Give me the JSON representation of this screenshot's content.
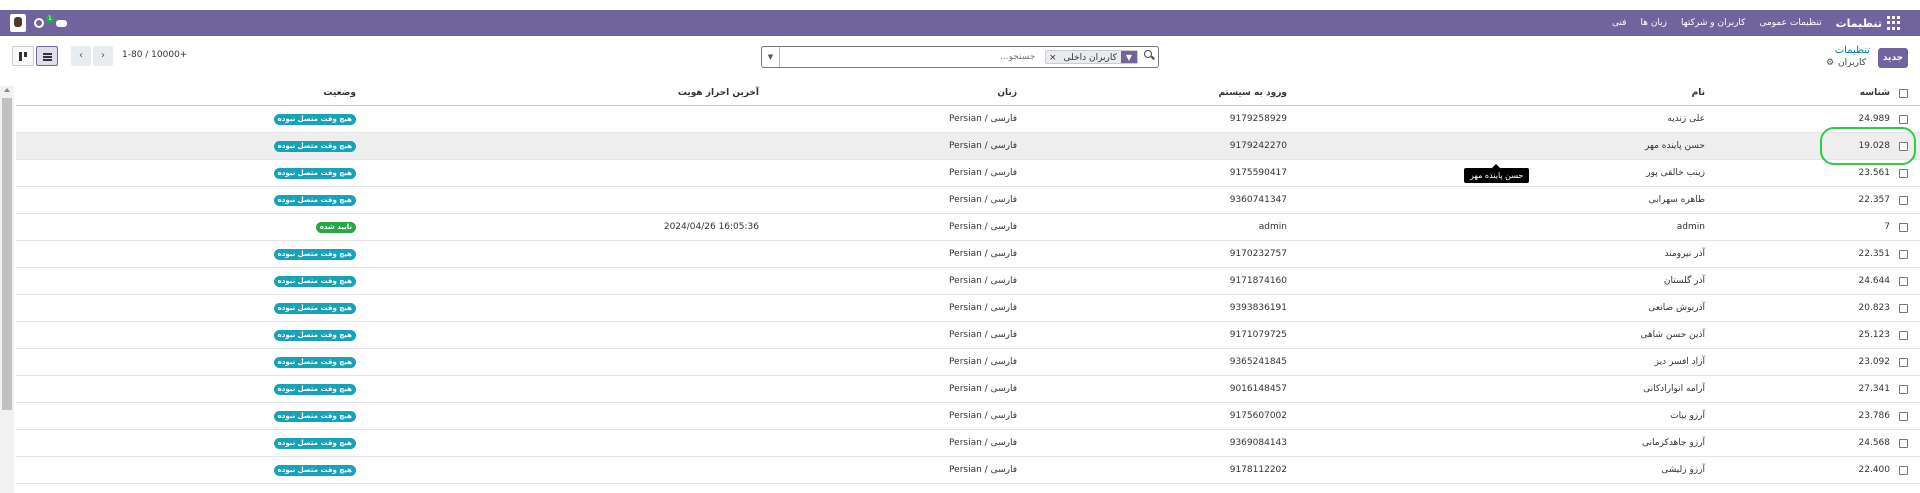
{
  "navbar": {
    "brand": "تنظیمات",
    "menu": [
      "تنظیمات عمومی",
      "کاربران و شرکتها",
      "زبان ها",
      "فنی"
    ],
    "chat_count": "1"
  },
  "control": {
    "new_button": "جدید",
    "breadcrumb_parent": "تنظیمات",
    "breadcrumb_current": "کاربران",
    "search_placeholder": "جستجو...",
    "facet_label": "کاربران داخلی",
    "facet_remove": "×",
    "pager_text": "1-80 / 10000+",
    "prev": "‹",
    "next": "›"
  },
  "columns": {
    "id": "شناسه",
    "name": "نام",
    "login": "ورود به سیستم",
    "lang": "زبان",
    "last_auth": "آخرین احراز هویت",
    "state": "وضعیت"
  },
  "rows": [
    {
      "id": "24.989",
      "name": "علی زندیه",
      "login": "9179258929",
      "lang": "Persian / فارسی",
      "auth": "",
      "state": "هیچ وقت متصل نبوده",
      "state_kind": "never"
    },
    {
      "id": "19.028",
      "name": "حسن پاینده مهر",
      "login": "9179242270",
      "lang": "Persian / فارسی",
      "auth": "",
      "state": "هیچ وقت متصل نبوده",
      "state_kind": "never"
    },
    {
      "id": "23.561",
      "name": "زینب خالقی پور",
      "login": "9175590417",
      "lang": "Persian / فارسی",
      "auth": "",
      "state": "هیچ وقت متصل نبوده",
      "state_kind": "never"
    },
    {
      "id": "22.357",
      "name": "طاهره سهرابی",
      "login": "9360741347",
      "lang": "Persian / فارسی",
      "auth": "",
      "state": "هیچ وقت متصل نبوده",
      "state_kind": "never"
    },
    {
      "id": "7",
      "name": "admin",
      "login": "admin",
      "lang": "Persian / فارسی",
      "auth": "2024/04/26 16:05:36",
      "state": "تایید شده",
      "state_kind": "ok"
    },
    {
      "id": "22.351",
      "name": "آذر نیرومند",
      "login": "9170232757",
      "lang": "Persian / فارسی",
      "auth": "",
      "state": "هیچ وقت متصل نبوده",
      "state_kind": "never"
    },
    {
      "id": "24.644",
      "name": "آذر گلستان",
      "login": "9171874160",
      "lang": "Persian / فارسی",
      "auth": "",
      "state": "هیچ وقت متصل نبوده",
      "state_kind": "never"
    },
    {
      "id": "20.823",
      "name": "آذربوش صانعی",
      "login": "9393836191",
      "lang": "Persian / فارسی",
      "auth": "",
      "state": "هیچ وقت متصل نبوده",
      "state_kind": "never"
    },
    {
      "id": "25.123",
      "name": "آذین حسن شاهی",
      "login": "9171079725",
      "lang": "Persian / فارسی",
      "auth": "",
      "state": "هیچ وقت متصل نبوده",
      "state_kind": "never"
    },
    {
      "id": "23.092",
      "name": "آزاد افسر دیز",
      "login": "9365241845",
      "lang": "Persian / فارسی",
      "auth": "",
      "state": "هیچ وقت متصل نبوده",
      "state_kind": "never"
    },
    {
      "id": "27.341",
      "name": "آرامه انوارادکانی",
      "login": "9016148457",
      "lang": "Persian / فارسی",
      "auth": "",
      "state": "هیچ وقت متصل نبوده",
      "state_kind": "never"
    },
    {
      "id": "23.786",
      "name": "آرزو بیات",
      "login": "9175607002",
      "lang": "Persian / فارسی",
      "auth": "",
      "state": "هیچ وقت متصل نبوده",
      "state_kind": "never"
    },
    {
      "id": "24.568",
      "name": "آرزو جاهدکرمانی",
      "login": "9369084143",
      "lang": "Persian / فارسی",
      "auth": "",
      "state": "هیچ وقت متصل نبوده",
      "state_kind": "never"
    },
    {
      "id": "22.400",
      "name": "آرزو زلیشی",
      "login": "9178112202",
      "lang": "Persian / فارسی",
      "auth": "",
      "state": "هیچ وقت متصل نبوده",
      "state_kind": "never"
    }
  ],
  "tooltip": "حسن پاینده مهر",
  "colors": {
    "brand": "#71639e",
    "never_badge": "#17a2b8",
    "ok_badge": "#28a745",
    "highlight_ring": "#2ecc40"
  },
  "icons": [
    "apps-grid-icon",
    "avatar-icon",
    "clock-icon",
    "chat-icon",
    "search-icon",
    "filter-icon",
    "gear-icon",
    "kanban-view-icon",
    "list-view-icon"
  ]
}
